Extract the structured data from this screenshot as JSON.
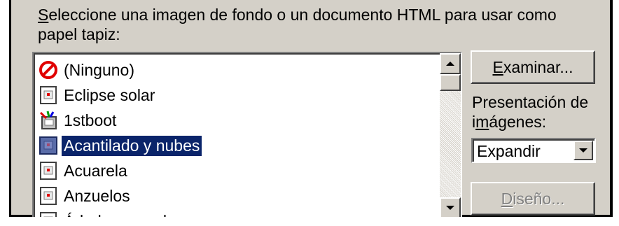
{
  "prompt": {
    "line1_accel": "S",
    "line1_rest": "eleccione una imagen de fondo o un documento HTML para usar como",
    "line2": "papel tapiz:"
  },
  "wallpaper_list": {
    "selected_index": 3,
    "items": [
      {
        "label": "(Ninguno)",
        "icon": "none-icon"
      },
      {
        "label": " Eclipse solar",
        "icon": "image-file-icon"
      },
      {
        "label": "1stboot",
        "icon": "setup-app-icon"
      },
      {
        "label": "Acantilado y nubes",
        "icon": "image-file-icon"
      },
      {
        "label": "Acuarela",
        "icon": "image-file-icon"
      },
      {
        "label": "Anzuelos",
        "icon": "image-file-icon"
      },
      {
        "label": "Árboles nevados",
        "icon": "image-file-icon"
      }
    ]
  },
  "browse_button": {
    "accel": "E",
    "rest": "xaminar..."
  },
  "presentation": {
    "line1": "Presentación de",
    "line2_pre": "i",
    "line2_accel": "m",
    "line2_rest": "ágenes:",
    "selected_value": "Expandir"
  },
  "design_button": {
    "accel": "D",
    "rest": "iseño...",
    "enabled": false
  },
  "colors": {
    "selection": "#0a246a",
    "face": "#d4d0c8"
  }
}
